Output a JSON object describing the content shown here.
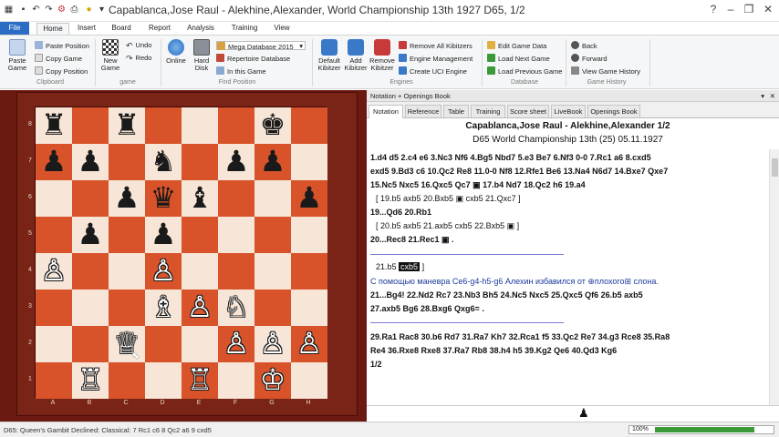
{
  "window": {
    "title": "Capablanca,Jose Raul - Alekhine,Alexander, World Championship 13th 1927  D65, 1/2"
  },
  "ribbon_tabs": [
    "File",
    "Home",
    "Insert",
    "Board",
    "Report",
    "Analysis",
    "Training",
    "View"
  ],
  "ribbon": {
    "clipboard": {
      "big": "Paste Game",
      "items": [
        "Paste Position",
        "Copy Game",
        "Copy Position"
      ],
      "group": "Clipboard"
    },
    "game": {
      "big": "New Game",
      "items": [
        "Undo",
        "Redo"
      ],
      "group": "game"
    },
    "find_position": {
      "big1": "Online",
      "big2": "Hard Disk",
      "db": "Mega Database 2015",
      "items": [
        "Repertoire Database",
        "In this Game"
      ],
      "group": "Find Position"
    },
    "engines": {
      "big1": "Default Kibitzer",
      "big2": "Add Kibitzer",
      "big3": "Remove Kibitzer",
      "items": [
        "Remove All Kibitzers",
        "Engine Management",
        "Create UCI Engine"
      ],
      "group": "Engines"
    },
    "database": {
      "items": [
        "Edit Game Data",
        "Load Next Game",
        "Load Previous Game"
      ],
      "group": "Database"
    },
    "game_history": {
      "items": [
        "Back",
        "Forward",
        "View Game History"
      ],
      "group": "Game History"
    }
  },
  "colors": {
    "accent": "#2b6cc4",
    "dark_square": "#d8532a",
    "light_square": "#f7e6d7",
    "frame": "#6b1a12"
  },
  "board": {
    "ranks": [
      "8",
      "7",
      "6",
      "5",
      "4",
      "3",
      "2",
      "1"
    ],
    "files": [
      "A",
      "B",
      "C",
      "D",
      "E",
      "F",
      "G",
      "H"
    ],
    "pieces": [
      {
        "sq": "a8",
        "g": "♜",
        "c": "b"
      },
      {
        "sq": "c8",
        "g": "♜",
        "c": "b"
      },
      {
        "sq": "g8",
        "g": "♚",
        "c": "b"
      },
      {
        "sq": "a7",
        "g": "♟",
        "c": "b"
      },
      {
        "sq": "b7",
        "g": "♟",
        "c": "b"
      },
      {
        "sq": "d7",
        "g": "♞",
        "c": "b"
      },
      {
        "sq": "f7",
        "g": "♟",
        "c": "b"
      },
      {
        "sq": "g7",
        "g": "♟",
        "c": "b"
      },
      {
        "sq": "c6",
        "g": "♟",
        "c": "b"
      },
      {
        "sq": "d6",
        "g": "♛",
        "c": "b"
      },
      {
        "sq": "e6",
        "g": "♝",
        "c": "b"
      },
      {
        "sq": "h6",
        "g": "♟",
        "c": "b"
      },
      {
        "sq": "b5",
        "g": "♟",
        "c": "b"
      },
      {
        "sq": "d5",
        "g": "♟",
        "c": "b"
      },
      {
        "sq": "a4",
        "g": "♙",
        "c": "w"
      },
      {
        "sq": "d4",
        "g": "♙",
        "c": "w"
      },
      {
        "sq": "d3",
        "g": "♗",
        "c": "w"
      },
      {
        "sq": "e3",
        "g": "♙",
        "c": "w"
      },
      {
        "sq": "f3",
        "g": "♘",
        "c": "w"
      },
      {
        "sq": "c2",
        "g": "♕",
        "c": "w"
      },
      {
        "sq": "f2",
        "g": "♙",
        "c": "w"
      },
      {
        "sq": "g2",
        "g": "♙",
        "c": "w"
      },
      {
        "sq": "h2",
        "g": "♙",
        "c": "w"
      },
      {
        "sq": "b1",
        "g": "♖",
        "c": "w"
      },
      {
        "sq": "e1",
        "g": "♖",
        "c": "w"
      },
      {
        "sq": "g1",
        "g": "♔",
        "c": "w"
      }
    ]
  },
  "notation": {
    "panel_title": "Notation + Openings Book",
    "tabs": [
      "Notation",
      "Reference",
      "Table",
      "Training",
      "Score sheet",
      "LiveBook",
      "Openings Book"
    ],
    "header1": "Capablanca,Jose Raul - Alekhine,Alexander  1/2",
    "header2": "D65  World Championship 13th (25) 05.11.1927",
    "lines": [
      "1.d4  d5  2.c4  e6  3.Nc3  Nf6  4.Bg5  Nbd7  5.e3  Be7  6.Nf3  0-0  7.Rc1  a6  8.cxd5",
      "exd5  9.Bd3  c6  10.Qc2  Re8  11.0-0  Nf8  12.Rfe1  Be6  13.Na4  N6d7  14.Bxe7  Qxe7",
      "15.Nc5  Nxc5  16.Qxc5  Qc7 ▣  17.b4  Nd7  18.Qc2  h6  19.a4",
      "[ 19.b5  axb5  20.Bxb5 ▣  cxb5  21.Qxc7 ]",
      "19...Qd6  20.Rb1",
      "[ 20.b5  axb5  21.axb5  cxb5  22.Bxb5 ▣ ]",
      "20...Rec8  21.Rec1 ▣ .",
      "С помощью маневра Се6-g4-h5-g6 Алехин избавился от ⊕плохого⊞ слона.",
      "21...Bg4!  22.Nd2  Rc7  23.Nb3  Bh5  24.Nc5  Nxc5  25.Qxc5  Qf6  26.b5  axb5",
      "27.axb5  Bg6  28.Bxg6  Qxg6= .",
      "29.Ra1  Rac8  30.b6  Rd7  31.Ra7  Kh7  32.Rca1  f5  33.Qc2  Re7  34.g3  Rce8  35.Ra8",
      "Re4  36.Rxe8  Rxe8  37.Ra7  Rb8  38.h4  h5  39.Kg2  Qe6  40.Qd3  Kg6",
      "1/2"
    ],
    "input_move1": "21.b5",
    "input_move2": "cxb5"
  },
  "status": {
    "text": "D65: Queen's Gambit Declined: Classical: 7 Rc1 c6 8 Qc2 a6 9 cxd5",
    "zoom": "100%",
    "zoom_level": 0.85
  }
}
